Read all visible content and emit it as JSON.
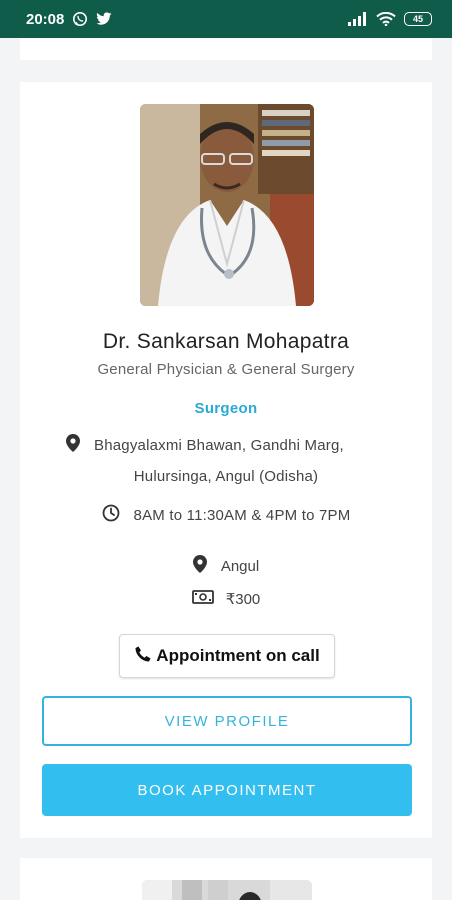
{
  "status_bar": {
    "time": "20:08",
    "battery": "45"
  },
  "doctor": {
    "name": "Dr. Sankarsan Mohapatra",
    "specialty": "General Physician & General Surgery",
    "role": "Surgeon",
    "address_line1": "Bhagyalaxmi Bhawan, Gandhi Marg,",
    "address_line2": "Hulursinga, Angul (Odisha)",
    "hours": "8AM to 11:30AM & 4PM to 7PM",
    "city": "Angul",
    "fee": "₹300"
  },
  "actions": {
    "call_label": "Appointment on call",
    "view_profile_label": "VIEW PROFILE",
    "book_label": "BOOK APPOINTMENT"
  },
  "icons": {
    "status": [
      "whatsapp-icon",
      "twitter-icon",
      "signal-icon",
      "wifi-icon",
      "battery-icon"
    ],
    "card": [
      "location-pin-icon",
      "clock-icon",
      "cash-icon",
      "phone-icon"
    ]
  },
  "colors": {
    "status_bar": "#0f5c4a",
    "accent": "#35b2dd",
    "book_button": "#32bff0"
  }
}
